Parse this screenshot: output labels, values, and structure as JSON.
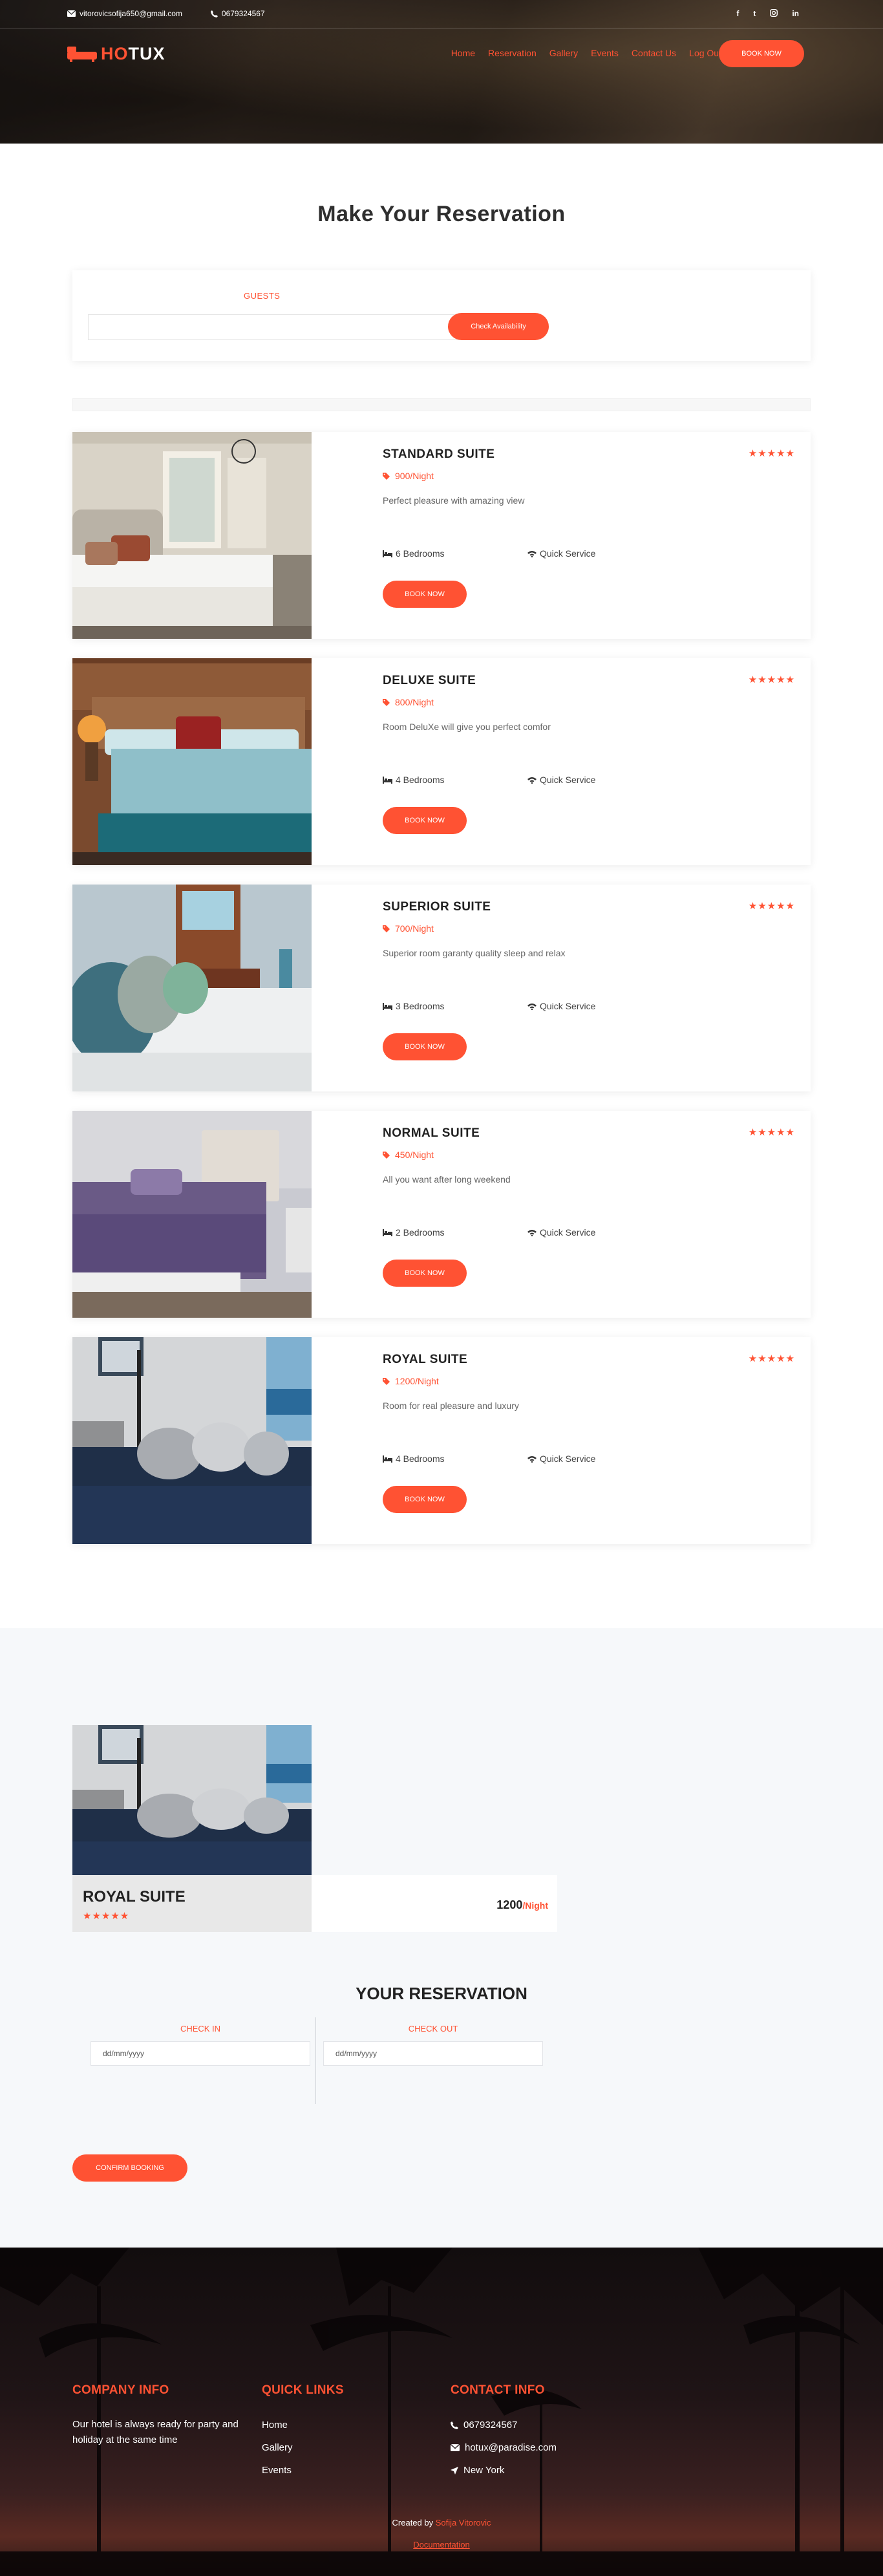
{
  "topbar": {
    "email": "vitorovicsofija650@gmail.com",
    "phone": "0679324567",
    "social": [
      "f",
      "t",
      "ig",
      "in"
    ]
  },
  "nav": {
    "logo_accent": "HO",
    "logo_rest": "TUX",
    "items": [
      "Home",
      "Reservation",
      "Gallery",
      "Events",
      "Contact Us",
      "Log Out"
    ],
    "book_label": "BOOK NOW"
  },
  "page_title": "Make Your Reservation",
  "search": {
    "guests_label": "GUESTS",
    "guests_value": "",
    "check_label": "Check Availability"
  },
  "rooms": [
    {
      "name": "STANDARD SUITE",
      "price": "900/Night",
      "desc": "Perfect pleasure with amazing view",
      "bedrooms": "6 Bedrooms",
      "service": "Quick Service",
      "stars": "★★★★★",
      "book": "BOOK NOW"
    },
    {
      "name": "DELUXE SUITE",
      "price": "800/Night",
      "desc": "Room DeluXe will give you perfect comfor",
      "bedrooms": "4 Bedrooms",
      "service": "Quick Service",
      "stars": "★★★★★",
      "book": "BOOK NOW"
    },
    {
      "name": "SUPERIOR SUITE",
      "price": "700/Night",
      "desc": "Superior room garanty quality sleep and relax",
      "bedrooms": "3 Bedrooms",
      "service": "Quick Service",
      "stars": "★★★★★",
      "book": "BOOK NOW"
    },
    {
      "name": "NORMAL SUITE",
      "price": "450/Night",
      "desc": "All you want after long weekend",
      "bedrooms": "2 Bedrooms",
      "service": "Quick Service",
      "stars": "★★★★★",
      "book": "BOOK NOW"
    },
    {
      "name": "ROYAL SUITE",
      "price": "1200/Night",
      "desc": "Room for real pleasure and luxury",
      "bedrooms": "4 Bedrooms",
      "service": "Quick Service",
      "stars": "★★★★★",
      "book": "BOOK NOW"
    }
  ],
  "selected": {
    "name": "ROYAL SUITE",
    "stars": "★★★★★",
    "price": "1200",
    "unit": "/Night"
  },
  "reservation": {
    "title": "YOUR RESERVATION",
    "checkin_label": "CHECK IN",
    "checkin_value": "dd/mm/yyyy",
    "checkout_label": "CHECK OUT",
    "checkout_value": "dd/mm/yyyy",
    "confirm_label": "CONFIRM BOOKING"
  },
  "footer": {
    "company_title": "COMPANY INFO",
    "company_text": "Our hotel is always ready for party and holiday at the same time",
    "links_title": "QUICK LINKS",
    "links": [
      "Home",
      "Gallery",
      "Events"
    ],
    "contact_title": "CONTACT INFO",
    "phone": "0679324567",
    "email": "hotux@paradise.com",
    "location": "New York",
    "credit_prefix": "Created by",
    "credit_name": "Sofija Vitorovic",
    "doc_link": "Documentation"
  },
  "colors": {
    "accent": "#ff5233",
    "text_dark": "#222222",
    "gray_bg": "#f6f8fa"
  }
}
